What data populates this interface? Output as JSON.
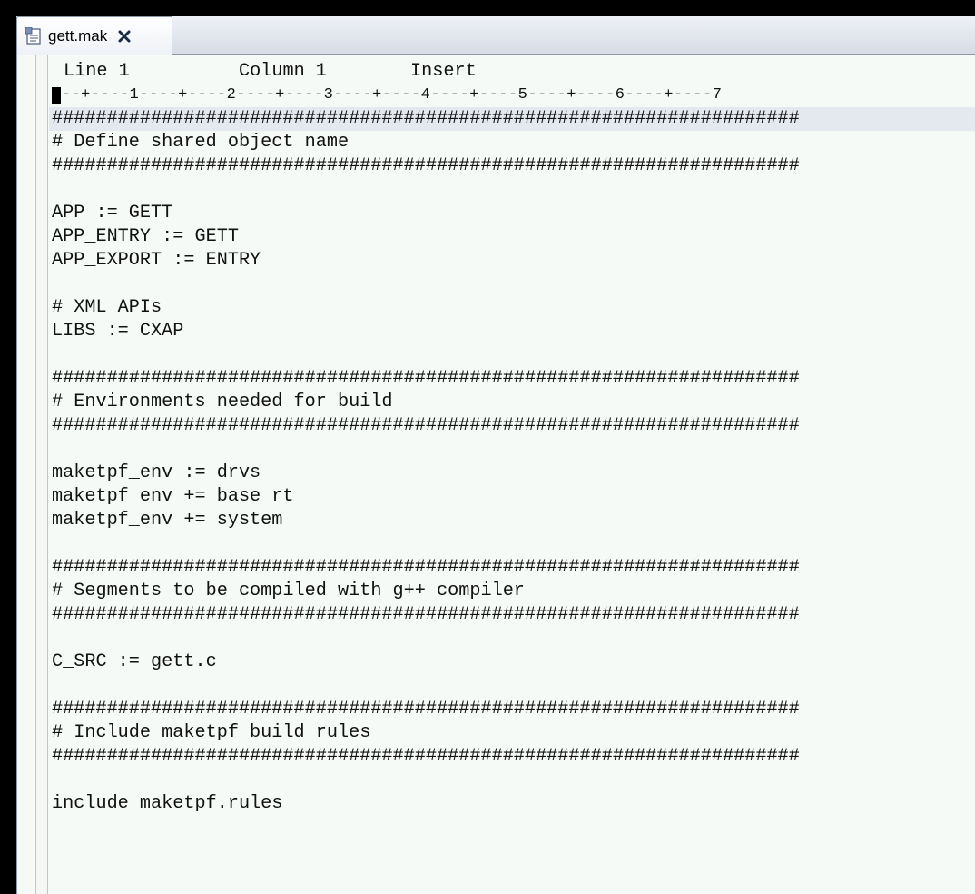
{
  "tab": {
    "icon": "document-icon",
    "label": "gett.mak",
    "close_icon": "close-icon"
  },
  "status": {
    "line": "Line 1",
    "column": "Column 1",
    "mode": "Insert"
  },
  "ruler": "---+----1----+----2----+----3----+----4----+----5----+----6----+----7",
  "lines": [
    "####################################################################",
    "# Define shared object name",
    "####################################################################",
    "",
    "APP := GETT",
    "APP_ENTRY := GETT",
    "APP_EXPORT := ENTRY",
    "",
    "# XML APIs",
    "LIBS := CXAP",
    "",
    "####################################################################",
    "# Environments needed for build",
    "####################################################################",
    "",
    "maketpf_env := drvs",
    "maketpf_env += base_rt",
    "maketpf_env += system",
    "",
    "####################################################################",
    "# Segments to be compiled with g++ compiler",
    "####################################################################",
    "",
    "C_SRC := gett.c",
    "",
    "####################################################################",
    "# Include maketpf build rules",
    "####################################################################",
    "",
    "include maketpf.rules"
  ],
  "colors": {
    "editor_background": "#f6faf6",
    "current_line": "#e3e9ef",
    "tab_border": "#8e97a8"
  }
}
